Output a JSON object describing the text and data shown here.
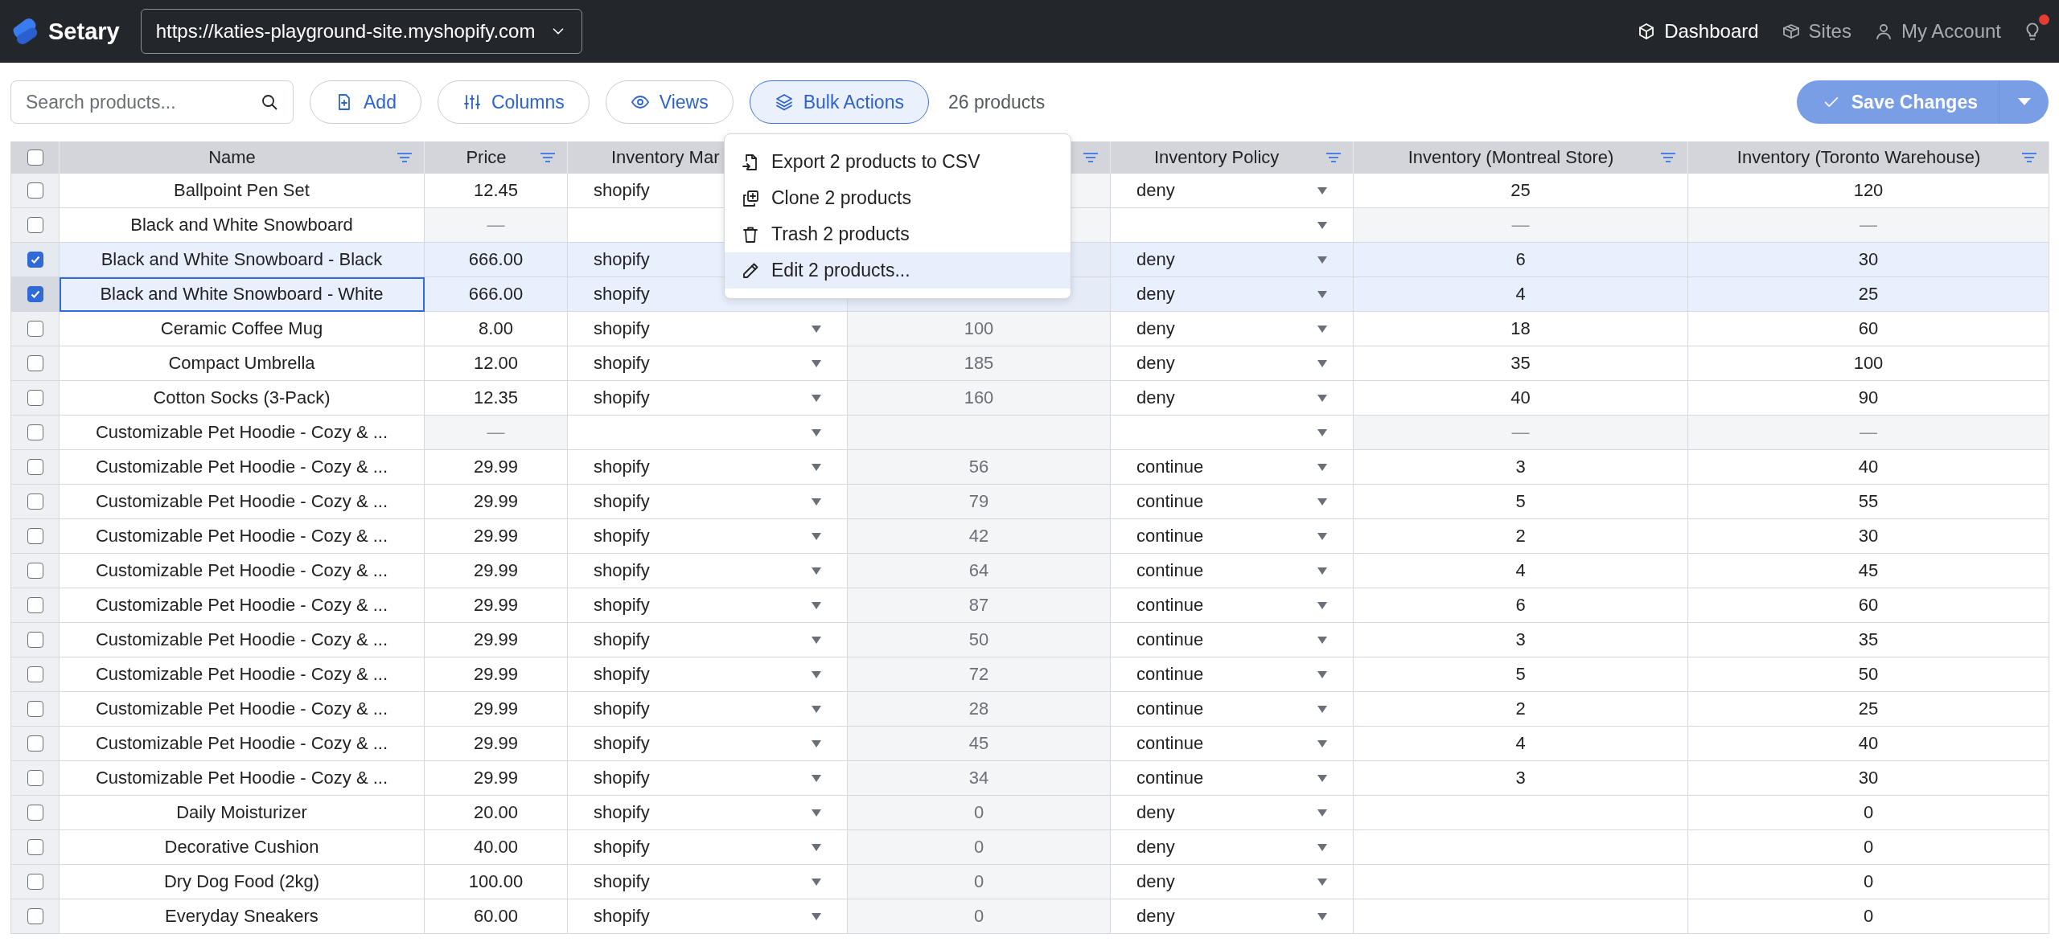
{
  "header": {
    "brand": "Setary",
    "site_url": "https://katies-playground-site.myshopify.com",
    "has_notification": true,
    "nav": [
      {
        "label": "Dashboard",
        "kind": "cube",
        "selected": true
      },
      {
        "label": "Sites",
        "kind": "box",
        "selected": false
      },
      {
        "label": "My Account",
        "kind": "person",
        "selected": false
      }
    ]
  },
  "toolbar": {
    "search": {
      "placeholder": "Search products..."
    },
    "buttons": [
      {
        "label": "Add",
        "kind": "add",
        "selected": false
      },
      {
        "label": "Columns",
        "kind": "columns",
        "selected": false
      },
      {
        "label": "Views",
        "kind": "views",
        "selected": false
      },
      {
        "label": "Bulk Actions",
        "kind": "bulk",
        "selected": true
      }
    ],
    "count": "26 products",
    "save_button": "Save Changes"
  },
  "bulk_menu": {
    "items": [
      {
        "label": "Export 2 products to CSV",
        "kind": "export",
        "highlighted": false
      },
      {
        "label": "Clone 2 products",
        "kind": "clone",
        "highlighted": false
      },
      {
        "label": "Trash 2 products",
        "kind": "trash",
        "highlighted": false
      },
      {
        "label": "Edit 2 products...",
        "kind": "edit",
        "highlighted": true
      }
    ]
  },
  "table": {
    "all_selected": false,
    "columns": [
      {
        "label": "Name",
        "kind": "text"
      },
      {
        "label": "Price",
        "kind": "text"
      },
      {
        "label": "Inventory Mar",
        "kind": "select"
      },
      {
        "kind": "readonly"
      },
      {
        "label": "Inventory Policy",
        "kind": "select"
      },
      {
        "label": "Inventory (Montreal Store)",
        "kind": "text"
      },
      {
        "label": "Inventory (Toronto Warehouse)",
        "kind": "text"
      }
    ],
    "rows": [
      {
        "kind": "item",
        "selected": false,
        "focused": false,
        "name": "Ballpoint Pen Set",
        "price": "12.45",
        "management": "shopify",
        "policy": "deny",
        "montreal": "25",
        "toronto": "120"
      },
      {
        "kind": "parent",
        "selected": false,
        "focused": false,
        "name": "Black and White Snowboard",
        "price": "—",
        "montreal": "—",
        "toronto": "—"
      },
      {
        "kind": "item",
        "selected": true,
        "focused": false,
        "name": "Black and White Snowboard - Black",
        "price": "666.00",
        "management": "shopify",
        "policy": "deny",
        "montreal": "6",
        "toronto": "30"
      },
      {
        "kind": "item",
        "selected": true,
        "focused": true,
        "name": "Black and White Snowboard - White",
        "price": "666.00",
        "management": "shopify",
        "policy": "deny",
        "montreal": "4",
        "toronto": "25"
      },
      {
        "kind": "item",
        "selected": false,
        "focused": false,
        "name": "Ceramic Coffee Mug",
        "price": "8.00",
        "management": "shopify",
        "quantity": "100",
        "policy": "deny",
        "montreal": "18",
        "toronto": "60"
      },
      {
        "kind": "item",
        "selected": false,
        "focused": false,
        "name": "Compact Umbrella",
        "price": "12.00",
        "management": "shopify",
        "quantity": "185",
        "policy": "deny",
        "montreal": "35",
        "toronto": "100"
      },
      {
        "kind": "item",
        "selected": false,
        "focused": false,
        "name": "Cotton Socks (3-Pack)",
        "price": "12.35",
        "management": "shopify",
        "quantity": "160",
        "policy": "deny",
        "montreal": "40",
        "toronto": "90"
      },
      {
        "kind": "parent",
        "selected": false,
        "focused": false,
        "name": "Customizable Pet Hoodie - Cozy & ...",
        "price": "—",
        "montreal": "—",
        "toronto": "—"
      },
      {
        "kind": "item",
        "selected": false,
        "focused": false,
        "name": "Customizable Pet Hoodie - Cozy & ...",
        "price": "29.99",
        "management": "shopify",
        "quantity": "56",
        "policy": "continue",
        "montreal": "3",
        "toronto": "40"
      },
      {
        "kind": "item",
        "selected": false,
        "focused": false,
        "name": "Customizable Pet Hoodie - Cozy & ...",
        "price": "29.99",
        "management": "shopify",
        "quantity": "79",
        "policy": "continue",
        "montreal": "5",
        "toronto": "55"
      },
      {
        "kind": "item",
        "selected": false,
        "focused": false,
        "name": "Customizable Pet Hoodie - Cozy & ...",
        "price": "29.99",
        "management": "shopify",
        "quantity": "42",
        "policy": "continue",
        "montreal": "2",
        "toronto": "30"
      },
      {
        "kind": "item",
        "selected": false,
        "focused": false,
        "name": "Customizable Pet Hoodie - Cozy & ...",
        "price": "29.99",
        "management": "shopify",
        "quantity": "64",
        "policy": "continue",
        "montreal": "4",
        "toronto": "45"
      },
      {
        "kind": "item",
        "selected": false,
        "focused": false,
        "name": "Customizable Pet Hoodie - Cozy & ...",
        "price": "29.99",
        "management": "shopify",
        "quantity": "87",
        "policy": "continue",
        "montreal": "6",
        "toronto": "60"
      },
      {
        "kind": "item",
        "selected": false,
        "focused": false,
        "name": "Customizable Pet Hoodie - Cozy & ...",
        "price": "29.99",
        "management": "shopify",
        "quantity": "50",
        "policy": "continue",
        "montreal": "3",
        "toronto": "35"
      },
      {
        "kind": "item",
        "selected": false,
        "focused": false,
        "name": "Customizable Pet Hoodie - Cozy & ...",
        "price": "29.99",
        "management": "shopify",
        "quantity": "72",
        "policy": "continue",
        "montreal": "5",
        "toronto": "50"
      },
      {
        "kind": "item",
        "selected": false,
        "focused": false,
        "name": "Customizable Pet Hoodie - Cozy & ...",
        "price": "29.99",
        "management": "shopify",
        "quantity": "28",
        "policy": "continue",
        "montreal": "2",
        "toronto": "25"
      },
      {
        "kind": "item",
        "selected": false,
        "focused": false,
        "name": "Customizable Pet Hoodie - Cozy & ...",
        "price": "29.99",
        "management": "shopify",
        "quantity": "45",
        "policy": "continue",
        "montreal": "4",
        "toronto": "40"
      },
      {
        "kind": "item",
        "selected": false,
        "focused": false,
        "name": "Customizable Pet Hoodie - Cozy & ...",
        "price": "29.99",
        "management": "shopify",
        "quantity": "34",
        "policy": "continue",
        "montreal": "3",
        "toronto": "30"
      },
      {
        "kind": "item",
        "selected": false,
        "focused": false,
        "name": "Daily Moisturizer",
        "price": "20.00",
        "management": "shopify",
        "quantity": "0",
        "policy": "deny",
        "toronto": "0"
      },
      {
        "kind": "item",
        "selected": false,
        "focused": false,
        "name": "Decorative Cushion",
        "price": "40.00",
        "management": "shopify",
        "quantity": "0",
        "policy": "deny",
        "toronto": "0"
      },
      {
        "kind": "item",
        "selected": false,
        "focused": false,
        "name": "Dry Dog Food (2kg)",
        "price": "100.00",
        "management": "shopify",
        "quantity": "0",
        "policy": "deny",
        "toronto": "0"
      },
      {
        "kind": "item",
        "selected": false,
        "focused": false,
        "name": "Everyday Sneakers",
        "price": "60.00",
        "management": "shopify",
        "quantity": "0",
        "policy": "deny",
        "toronto": "0"
      }
    ]
  }
}
